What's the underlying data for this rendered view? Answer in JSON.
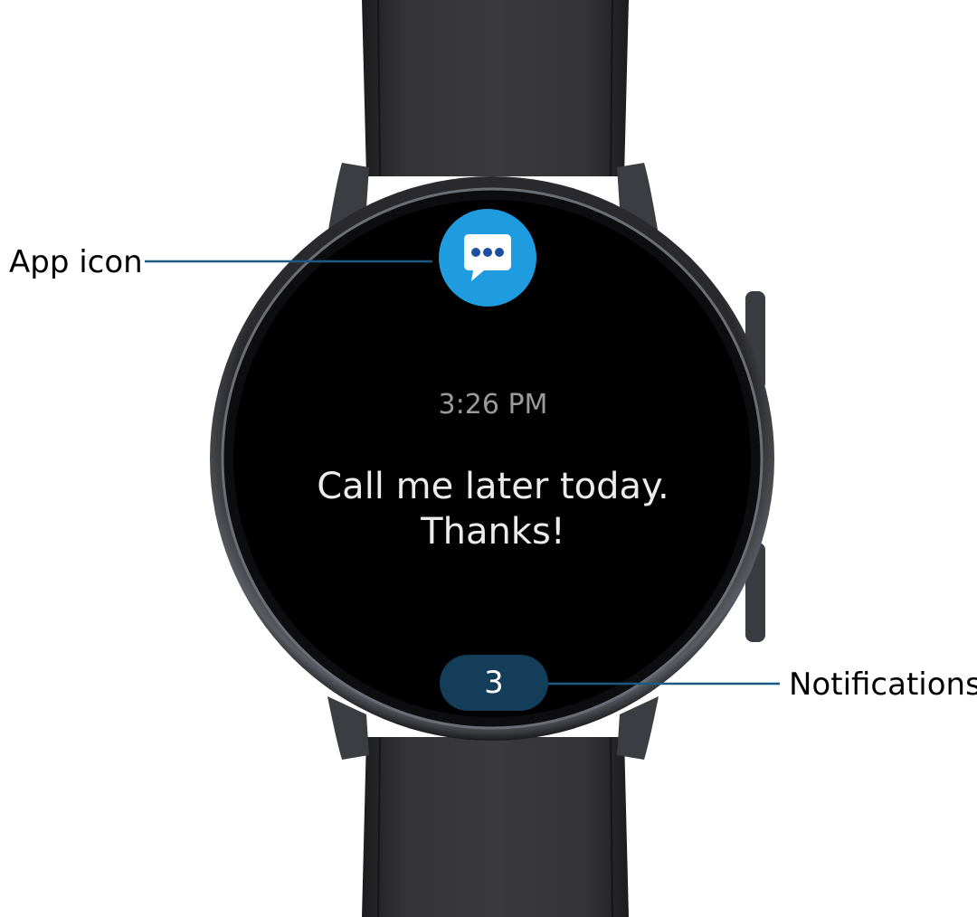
{
  "callouts": {
    "app_icon_label": "App icon",
    "notifications_label": "Notifications"
  },
  "watch_screen": {
    "time": "3:26 PM",
    "message_line1": "Call me later today.",
    "message_line2": "Thanks!",
    "notification_count": "3",
    "app_icon": "message-bubble-icon"
  },
  "colors": {
    "callout_line": "#1a5a85",
    "app_icon_bg": "#1f9be0",
    "notification_pill_bg": "#133d59",
    "screen_bg": "#000000",
    "strap": "#2c2c2e"
  }
}
